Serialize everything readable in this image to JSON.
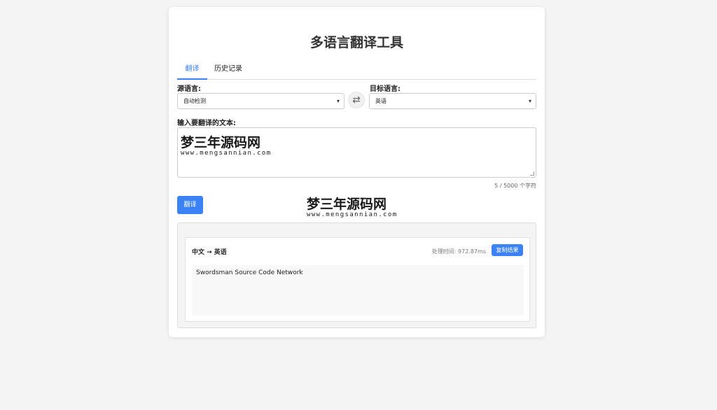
{
  "header": {
    "title": "多语言翻译工具"
  },
  "tabs": [
    {
      "label": "翻译",
      "active": true
    },
    {
      "label": "历史记录",
      "active": false
    }
  ],
  "source": {
    "label": "源语言:",
    "selected": "自动检测"
  },
  "target": {
    "label": "目标语言:",
    "selected": "英语"
  },
  "input": {
    "label": "输入要翻译的文本:",
    "counter": "5 / 5000 个字符",
    "watermark_main": "梦三年源码网",
    "watermark_url": "www.mengsannian.com"
  },
  "actions": {
    "translate_label": "翻译"
  },
  "watermark": {
    "main": "梦三年源码网",
    "url": "www.mengsannian.com"
  },
  "result": {
    "lang_pair": "中文 → 英语",
    "timing": "处理时间: 972.87ms",
    "copy_label": "复制结果",
    "text": "Swordsman Source Code Network"
  },
  "colors": {
    "accent": "#3b82f6",
    "background": "#f4f4f4"
  },
  "icons": {
    "swap": "swap-arrows-icon",
    "dropdown": "chevron-down-icon"
  }
}
